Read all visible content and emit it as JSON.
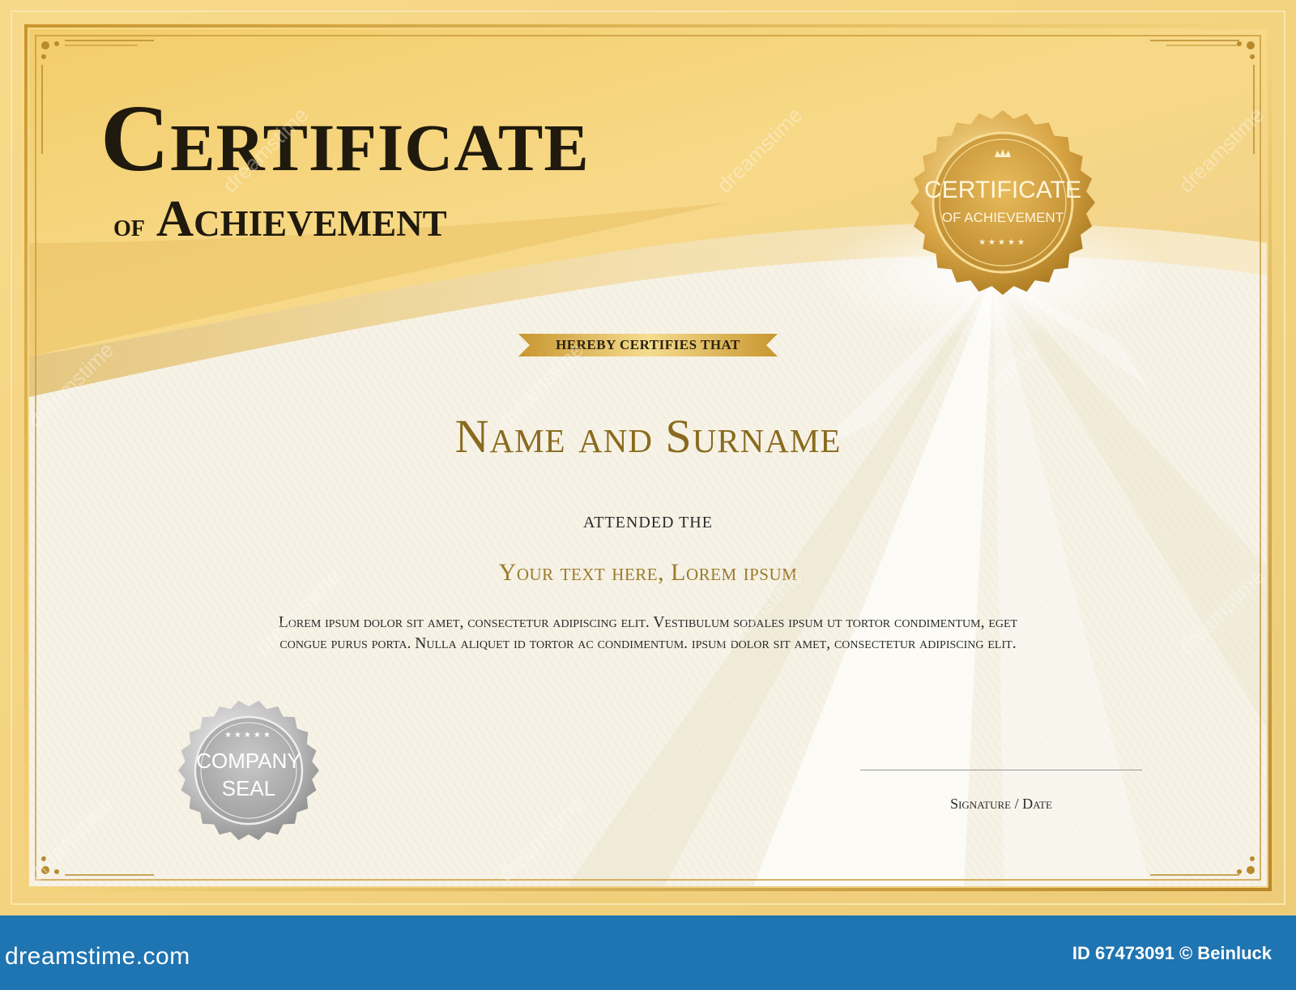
{
  "certificate": {
    "title": "Certificate",
    "subtitle_of": "of",
    "subtitle": "Achievement",
    "ribbon_text": "HEREBY CERTIFIES THAT",
    "recipient_name": "Name and Surname",
    "attended_text": "ATTENDED THE",
    "course_text": "Your text here, Lorem ipsum",
    "body_lines": [
      "Lorem ipsum dolor sit amet, consectetur adipiscing elit. Vestibulum sodales ipsum ut tortor condimentum, eget",
      "congue purus porta. Nulla aliquet id tortor ac condimentum. ipsum dolor sit amet, consectetur adipiscing elit."
    ],
    "signature_label": "Signature / Date"
  },
  "gold_seal": {
    "line1": "CERTIFICATE",
    "line2": "OF ACHIEVEMENT",
    "stars": "★★★★★"
  },
  "silver_seal": {
    "line1": "COMPANY",
    "line2": "SEAL",
    "stars": "★★★★★"
  },
  "footer": {
    "logo_text": "dreamstime.com",
    "image_id": "ID 67473091 © Beinluck"
  },
  "watermark_text": "dreamstime",
  "colors": {
    "gold_light": "#f7e3a1",
    "gold": "#e9c25d",
    "gold_dark": "#b88a2c",
    "footer_blue": "#1f74b2",
    "paper": "#f6f2e6"
  },
  "icons": [
    "crown-icon",
    "corner-ornament-icon",
    "star-icon"
  ]
}
